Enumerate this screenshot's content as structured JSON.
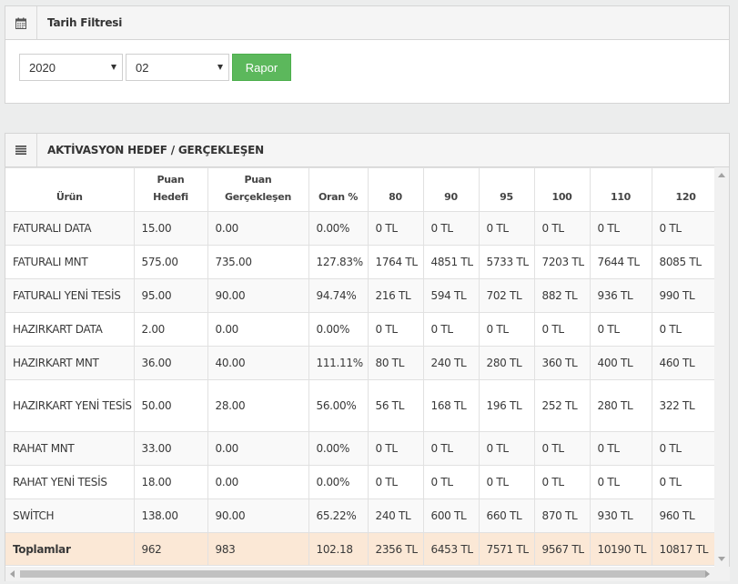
{
  "filter": {
    "title": "Tarih Filtresi",
    "icon": "calendar-icon",
    "year": "2020",
    "month": "02",
    "button_label": "Rapor"
  },
  "report": {
    "title": "AKTİVASYON HEDEF / GERÇEKLEŞEN",
    "icon": "list-icon",
    "headers": {
      "urun": "Ürün",
      "puan_hedefi_1": "Puan",
      "puan_hedefi_2": "Hedefi",
      "puan_gerceklesen": "Puan Gerçekleşen",
      "oran": "Oran %",
      "c80": "80",
      "c90": "90",
      "c95": "95",
      "c100": "100",
      "c110": "110",
      "c120": "120"
    },
    "rows": [
      {
        "urun": "FATURALI DATA",
        "hedef": "15.00",
        "gerceklesen": "0.00",
        "oran": "0.00%",
        "c80": "0 TL",
        "c90": "0 TL",
        "c95": "0 TL",
        "c100": "0 TL",
        "c110": "0 TL",
        "c120": "0 TL"
      },
      {
        "urun": "FATURALI MNT",
        "hedef": "575.00",
        "gerceklesen": "735.00",
        "oran": "127.83%",
        "c80": "1764 TL",
        "c90": "4851 TL",
        "c95": "5733 TL",
        "c100": "7203 TL",
        "c110": "7644 TL",
        "c120": "8085 TL"
      },
      {
        "urun": "FATURALI YENİ TESİS",
        "hedef": "95.00",
        "gerceklesen": "90.00",
        "oran": "94.74%",
        "c80": "216 TL",
        "c90": "594 TL",
        "c95": "702 TL",
        "c100": "882 TL",
        "c110": "936 TL",
        "c120": "990 TL"
      },
      {
        "urun": "HAZIRKART DATA",
        "hedef": "2.00",
        "gerceklesen": "0.00",
        "oran": "0.00%",
        "c80": "0 TL",
        "c90": "0 TL",
        "c95": "0 TL",
        "c100": "0 TL",
        "c110": "0 TL",
        "c120": "0 TL"
      },
      {
        "urun": "HAZIRKART MNT",
        "hedef": "36.00",
        "gerceklesen": "40.00",
        "oran": "111.11%",
        "c80": "80 TL",
        "c90": "240 TL",
        "c95": "280 TL",
        "c100": "360 TL",
        "c110": "400 TL",
        "c120": "460 TL"
      },
      {
        "urun": "HAZIRKART YENİ TESİS",
        "hedef": "50.00",
        "gerceklesen": "28.00",
        "oran": "56.00%",
        "c80": "56 TL",
        "c90": "168 TL",
        "c95": "196 TL",
        "c100": "252 TL",
        "c110": "280 TL",
        "c120": "322 TL"
      },
      {
        "urun": "RAHAT MNT",
        "hedef": "33.00",
        "gerceklesen": "0.00",
        "oran": "0.00%",
        "c80": "0 TL",
        "c90": "0 TL",
        "c95": "0 TL",
        "c100": "0 TL",
        "c110": "0 TL",
        "c120": "0 TL"
      },
      {
        "urun": "RAHAT YENİ TESİS",
        "hedef": "18.00",
        "gerceklesen": "0.00",
        "oran": "0.00%",
        "c80": "0 TL",
        "c90": "0 TL",
        "c95": "0 TL",
        "c100": "0 TL",
        "c110": "0 TL",
        "c120": "0 TL"
      },
      {
        "urun": "SWİTCH",
        "hedef": "138.00",
        "gerceklesen": "90.00",
        "oran": "65.22%",
        "c80": "240 TL",
        "c90": "600 TL",
        "c95": "660 TL",
        "c100": "870 TL",
        "c110": "930 TL",
        "c120": "960 TL"
      }
    ],
    "totals": {
      "urun": "Toplamlar",
      "hedef": "962",
      "gerceklesen": "983",
      "oran": "102.18",
      "c80": "2356 TL",
      "c90": "6453 TL",
      "c95": "7571 TL",
      "c100": "9567 TL",
      "c110": "10190 TL",
      "c120": "10817 TL"
    }
  }
}
